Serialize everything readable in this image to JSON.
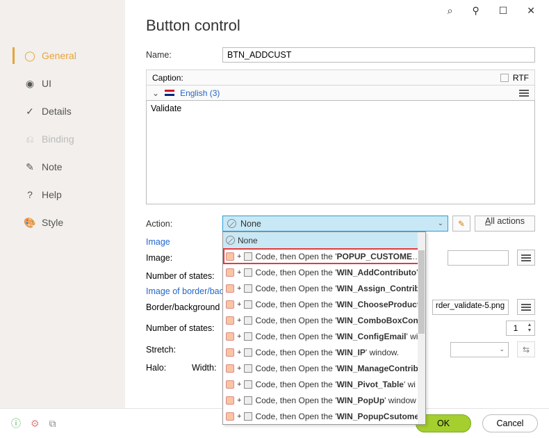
{
  "titlebar": {
    "search": "⌕",
    "pin": "⚲",
    "max": "☐",
    "close": "✕"
  },
  "nav": {
    "items": [
      {
        "label": "General",
        "active": true
      },
      {
        "label": "UI"
      },
      {
        "label": "Details"
      },
      {
        "label": "Binding"
      },
      {
        "label": "Note"
      },
      {
        "label": "Help"
      },
      {
        "label": "Style"
      }
    ]
  },
  "page": {
    "title": "Button control",
    "name_label": "Name:",
    "name_value": "BTN_ADDCUST",
    "caption_label": "Caption:",
    "rtf_label": "RTF",
    "lang_label": "English (3)",
    "caption_value": "Validate",
    "action_label": "Action:",
    "action_value": "None",
    "all_actions": "All actions",
    "image_head": "Image",
    "image_label": "Image:",
    "states_label": "Number of states:",
    "border_head": "Image of border/back",
    "border_label": "Border/background im",
    "border_value": "rder_validate-5.png",
    "states2_label": "Number of states:",
    "states2_value": "1",
    "stretch_label": "Stretch:",
    "halo_label": "Halo:",
    "width_label": "Width:"
  },
  "dropdown": {
    "items": [
      "None",
      "Code, then Open the 'POPUP_CUSTOMERS",
      "Code, then Open the 'WIN_AddContributo",
      "Code, then Open the 'WIN_Assign_Contrib",
      "Code, then Open the 'WIN_ChooseProduct",
      "Code, then Open the 'WIN_ComboBoxCon",
      "Code, then Open the 'WIN_ConfigEmail' wi",
      "Code, then Open the 'WIN_IP' window.",
      "Code, then Open the 'WIN_ManageContrib",
      "Code, then Open the 'WIN_Pivot_Table' wi",
      "Code, then Open the 'WIN_PopUp' window",
      "Code, then Open the 'WIN_PopupCsutome"
    ]
  },
  "footer": {
    "ok": "OK",
    "cancel": "Cancel"
  }
}
